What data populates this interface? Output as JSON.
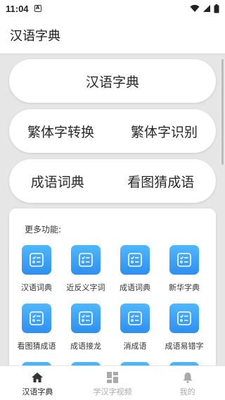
{
  "status_bar": {
    "time": "11:04",
    "notif_letter": "A"
  },
  "app_bar": {
    "title": "汉语字典"
  },
  "main_buttons": {
    "dictionary": "汉语字典",
    "row1": [
      "繁体字转换",
      "繁体字识别"
    ],
    "row2": [
      "成语词典",
      "看图猜成语"
    ]
  },
  "more": {
    "title": "更多功能:",
    "items": [
      {
        "label": "汉语词典"
      },
      {
        "label": "近反义字词"
      },
      {
        "label": "成语词典"
      },
      {
        "label": "新华字典"
      },
      {
        "label": "看图猜成语"
      },
      {
        "label": "成语接龙"
      },
      {
        "label": "消成语"
      },
      {
        "label": "成语易错字"
      },
      {
        "label": ""
      },
      {
        "label": ""
      },
      {
        "label": ""
      },
      {
        "label": ""
      }
    ]
  },
  "bottom_nav": {
    "items": [
      {
        "label": "汉语字典",
        "icon": "home-icon",
        "active": true
      },
      {
        "label": "学汉字视频",
        "icon": "grid-icon",
        "active": false
      },
      {
        "label": "我的",
        "icon": "bell-icon",
        "active": false
      }
    ]
  },
  "colors": {
    "accent": "#2e8ff0",
    "tile_top": "#4fb7ff",
    "background": "#e6e6e6"
  }
}
